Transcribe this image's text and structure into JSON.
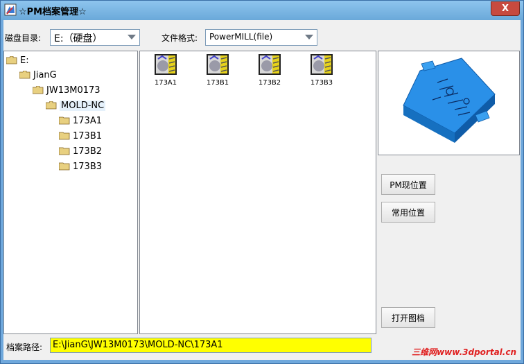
{
  "window": {
    "title": "☆PM档案管理☆",
    "close_label": "X"
  },
  "disk": {
    "label": "磁盘目录:",
    "value": "E:（硬盘）"
  },
  "format": {
    "label": "文件格式:",
    "value": "PowerMILL(file)"
  },
  "tree": [
    {
      "label": "E:",
      "depth": 0
    },
    {
      "label": "JianG",
      "depth": 1
    },
    {
      "label": "JW13M0173",
      "depth": 2
    },
    {
      "label": "MOLD-NC",
      "depth": 3,
      "selected": true
    },
    {
      "label": "173A1",
      "depth": 4
    },
    {
      "label": "173B1",
      "depth": 4
    },
    {
      "label": "173B2",
      "depth": 4
    },
    {
      "label": "173B3",
      "depth": 4
    }
  ],
  "files": [
    {
      "label": "173A1",
      "icon": "powermill-project-icon"
    },
    {
      "label": "173B1",
      "icon": "powermill-project-icon"
    },
    {
      "label": "173B2",
      "icon": "powermill-project-icon"
    },
    {
      "label": "173B3",
      "icon": "powermill-project-icon"
    }
  ],
  "buttons": {
    "pm_location": "PM现位置",
    "common_location": "常用位置",
    "open_archive": "打开图档"
  },
  "path": {
    "label": "档案路径:",
    "value": "E:\\JianG\\JW13M0173\\MOLD-NC\\173A1"
  },
  "watermark": "三维网www.3dportal.cn",
  "colors": {
    "title_bar": "#6aa9d9",
    "path_highlight": "#ffff00",
    "model_blue": "#1e8fe8",
    "close_button": "#c74a3f"
  }
}
